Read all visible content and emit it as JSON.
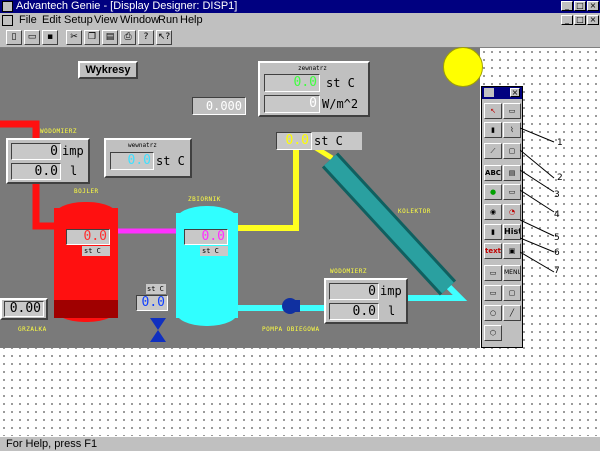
{
  "window": {
    "title": "Advantech Genie - [Display Designer: DISP1]"
  },
  "menu": [
    "File",
    "Edit",
    "Setup",
    "View",
    "Window",
    "Run",
    "Help"
  ],
  "toolbar_icons": [
    "new-icon",
    "open-icon",
    "save-icon",
    "cut-icon",
    "copy-icon",
    "paste-icon",
    "print-icon",
    "help-icon",
    "context-help-icon"
  ],
  "canvas": {
    "button_wykresy": "Wykresy",
    "value_display_top": "0.000",
    "sensor_zewnatrz": {
      "label": "zewnatrz",
      "temp_value": "0.0",
      "temp_unit": "st C",
      "rad_value": "0",
      "rad_unit": "W/m^2"
    },
    "sensor_wewnatrz": {
      "label": "wewnatrz",
      "value": "0.0",
      "unit": "st C"
    },
    "wodomierz_left": {
      "label": "WODOMIERZ",
      "imp_value": "0",
      "imp_unit": "imp",
      "vol_value": "0.0",
      "vol_unit": "l"
    },
    "wodomierz_right": {
      "label": "WODOMIERZ",
      "imp_value": "0",
      "imp_unit": "imp",
      "vol_value": "0.0",
      "vol_unit": "l"
    },
    "collector_temp": {
      "value": "0.0",
      "unit": "st C"
    },
    "bojler": {
      "label": "BOJLER",
      "value": "0.0",
      "unit": "st C"
    },
    "zbiornik": {
      "label": "ZBIORNIK",
      "value": "0.0",
      "unit": "st C"
    },
    "kolektor": {
      "label": "KOLEKTOR"
    },
    "valve_temp": {
      "unit": "st C",
      "value": "0.0"
    },
    "grzalka": {
      "label": "GRZALKA",
      "value": "0.00"
    },
    "pompa": {
      "label": "POMPA OBIEGOWA"
    }
  },
  "palette": {
    "button_labels": [
      "ABC",
      "Hist",
      "text",
      "MENU"
    ],
    "callouts": [
      "1",
      "2",
      "3",
      "4",
      "5",
      "6",
      "7"
    ]
  },
  "status": {
    "text": "For Help, press F1"
  },
  "colors": {
    "title_bg": "#000080",
    "panel_bg": "#7a7a7a",
    "bojler": "#ff1010",
    "zbiornik": "#30ffff",
    "pipe_red": "#ff1010",
    "pipe_yellow": "#ffff20",
    "pipe_cyan": "#40ffff",
    "pipe_magenta": "#ff30ff",
    "collector": "#2aa0a0",
    "sun": "#ffff00",
    "value_green": "#40ff40",
    "value_magenta": "#ff30ff",
    "value_red": "#ff3030",
    "value_cyan": "#40e0ff",
    "value_yellow": "#ffff00"
  }
}
